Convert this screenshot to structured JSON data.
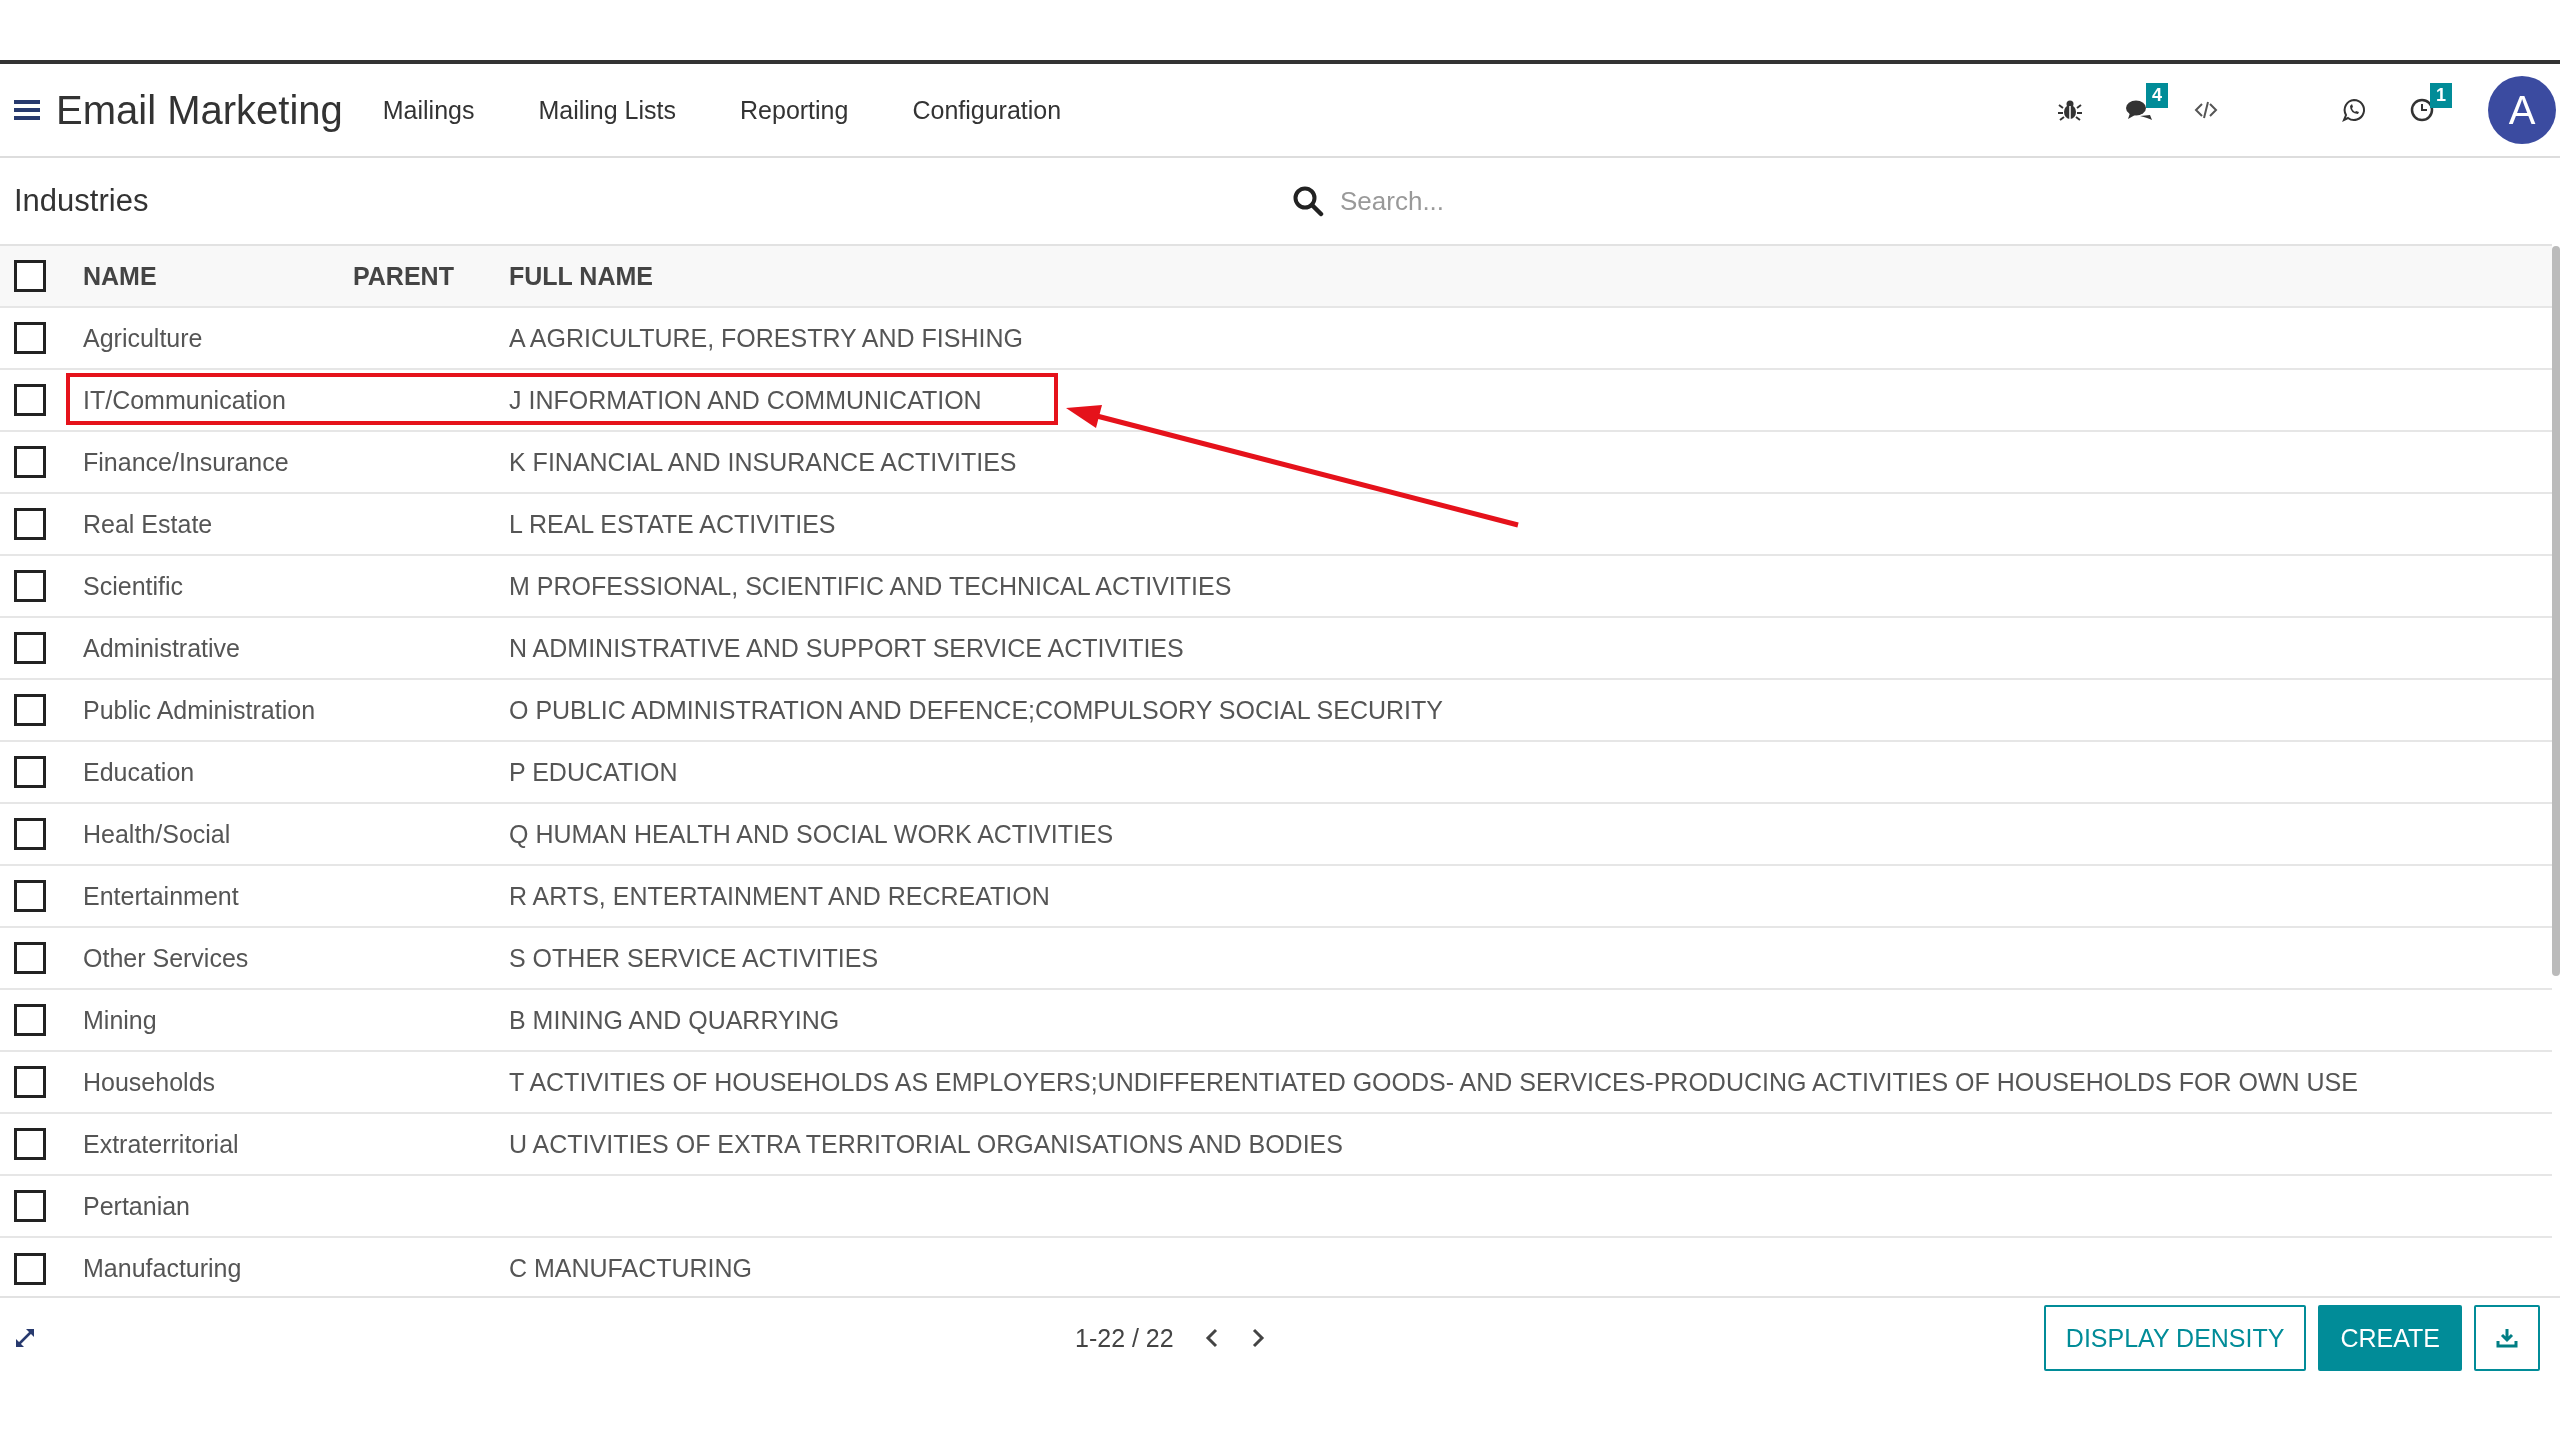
{
  "app": {
    "title": "Email Marketing"
  },
  "menu": [
    {
      "label": "Mailings"
    },
    {
      "label": "Mailing Lists"
    },
    {
      "label": "Reporting"
    },
    {
      "label": "Configuration"
    }
  ],
  "systray": [
    {
      "kind": "bug"
    },
    {
      "kind": "chat",
      "badge": "4"
    },
    {
      "kind": "code"
    },
    {
      "kind": "whatsapp"
    },
    {
      "kind": "clock",
      "badge": "1"
    }
  ],
  "user": {
    "initial": "A"
  },
  "breadcrumb": "Industries",
  "search": {
    "placeholder": "Search..."
  },
  "table": {
    "columns": [
      "NAME",
      "PARENT",
      "FULL NAME"
    ],
    "select_all": false,
    "rows": [
      {
        "name": "Agriculture",
        "parent": "",
        "full_name": "A AGRICULTURE, FORESTRY AND FISHING",
        "checked": false,
        "highlighted": false
      },
      {
        "name": "IT/Communication",
        "parent": "",
        "full_name": "J INFORMATION AND COMMUNICATION",
        "checked": false,
        "highlighted": true
      },
      {
        "name": "Finance/Insurance",
        "parent": "",
        "full_name": "K FINANCIAL AND INSURANCE ACTIVITIES",
        "checked": false,
        "highlighted": false
      },
      {
        "name": "Real Estate",
        "parent": "",
        "full_name": "L REAL ESTATE ACTIVITIES",
        "checked": false,
        "highlighted": false
      },
      {
        "name": "Scientific",
        "parent": "",
        "full_name": "M PROFESSIONAL, SCIENTIFIC AND TECHNICAL ACTIVITIES",
        "checked": false,
        "highlighted": false
      },
      {
        "name": "Administrative",
        "parent": "",
        "full_name": "N ADMINISTRATIVE AND SUPPORT SERVICE ACTIVITIES",
        "checked": false,
        "highlighted": false
      },
      {
        "name": "Public Administration",
        "parent": "",
        "full_name": "O PUBLIC ADMINISTRATION AND DEFENCE;COMPULSORY SOCIAL SECURITY",
        "checked": false,
        "highlighted": false
      },
      {
        "name": "Education",
        "parent": "",
        "full_name": "P EDUCATION",
        "checked": false,
        "highlighted": false
      },
      {
        "name": "Health/Social",
        "parent": "",
        "full_name": "Q HUMAN HEALTH AND SOCIAL WORK ACTIVITIES",
        "checked": false,
        "highlighted": false
      },
      {
        "name": "Entertainment",
        "parent": "",
        "full_name": "R ARTS, ENTERTAINMENT AND RECREATION",
        "checked": false,
        "highlighted": false
      },
      {
        "name": "Other Services",
        "parent": "",
        "full_name": "S OTHER SERVICE ACTIVITIES",
        "checked": false,
        "highlighted": false
      },
      {
        "name": "Mining",
        "parent": "",
        "full_name": "B MINING AND QUARRYING",
        "checked": false,
        "highlighted": false
      },
      {
        "name": "Households",
        "parent": "",
        "full_name": "T ACTIVITIES OF HOUSEHOLDS AS EMPLOYERS;UNDIFFERENTIATED GOODS- AND SERVICES-PRODUCING ACTIVITIES OF HOUSEHOLDS FOR OWN USE",
        "checked": false,
        "highlighted": false
      },
      {
        "name": "Extraterritorial",
        "parent": "",
        "full_name": "U ACTIVITIES OF EXTRA TERRITORIAL ORGANISATIONS AND BODIES",
        "checked": false,
        "highlighted": false
      },
      {
        "name": "Pertanian",
        "parent": "",
        "full_name": "",
        "checked": false,
        "highlighted": false
      },
      {
        "name": "Manufacturing",
        "parent": "",
        "full_name": "C MANUFACTURING",
        "checked": false,
        "highlighted": false
      }
    ]
  },
  "pager": {
    "range": "1-22 / 22"
  },
  "buttons": [
    {
      "label": "DISPLAY DENSITY",
      "kind": "outline"
    },
    {
      "label": "CREATE",
      "kind": "primary"
    },
    {
      "kind": "download"
    }
  ]
}
